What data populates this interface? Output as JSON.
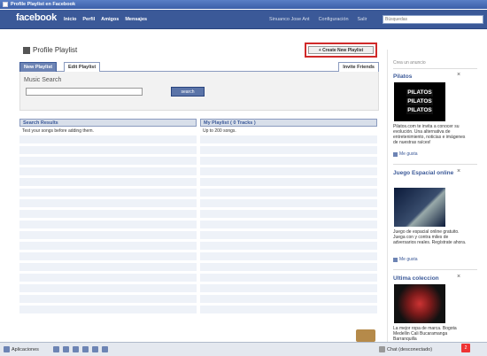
{
  "window": {
    "title": "Profile Playlist en Facebook"
  },
  "header": {
    "logo": "facebook",
    "nav": [
      "Inicio",
      "Perfil",
      "Amigos",
      "Mensajes"
    ],
    "user": "Sinuanco Jose Ant",
    "settings": "Configuración",
    "logout": "Salir",
    "search_placeholder": "Búsquedas"
  },
  "page": {
    "title": "Profile Playlist",
    "create_button": "+ Create New Playlist",
    "tabs": {
      "new_playlist": "New Playlist",
      "edit_playlist": "Edit Playlist",
      "invite_friends": "Invite Friends"
    },
    "music_search": {
      "label": "Music Search",
      "button": "search",
      "value": ""
    },
    "search_results": {
      "header": "Search Results",
      "hint": "Test your songs before adding them."
    },
    "my_playlist": {
      "header": "My Playlist ( 0 Tracks )",
      "hint": "Up to 200 songs."
    }
  },
  "sidebar": {
    "create_ad": "Crea un anuncio",
    "ads": [
      {
        "title": "Pilatos",
        "image_text": [
          "PILATOS",
          "PILATOS",
          "PILATOS"
        ],
        "text": "Pilatos.com te invita a conocer su evolución. Una alternativa de entretenimiento, noticias e imágenes de nuestras raíces!",
        "like": "Me gusta"
      },
      {
        "title": "Juego Espacial online",
        "text": "Juego de espacial online gratuito. Juega con y contra miles de adversarios reales. Regístrate ahora.",
        "like": "Me gusta"
      },
      {
        "title": "Ultima coleccion",
        "text": "La mejor ropa de marca. Bogota Medellin Cali Bucaramanga Barranquilla"
      }
    ]
  },
  "chatbar": {
    "apps": "Aplicaciones",
    "chat": "Chat (desconectado)",
    "notifications": "2"
  }
}
